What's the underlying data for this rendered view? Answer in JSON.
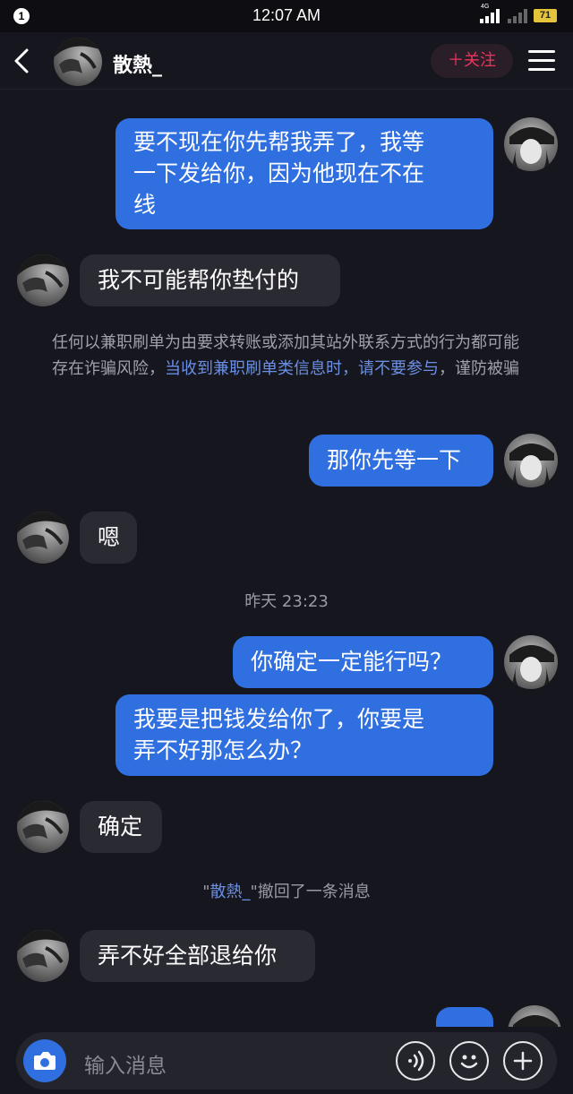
{
  "status_bar": {
    "notification_count": "1",
    "time": "12:07 AM",
    "network": "4G",
    "battery": "71"
  },
  "header": {
    "contact_name": "散熱_",
    "follow_label": "关注"
  },
  "messages": [
    {
      "from": "me",
      "text_lines": [
        "要不现在你先帮我弄了，我等",
        "一下发给你，因为他现在不在",
        "线"
      ]
    },
    {
      "from": "them",
      "text_lines": [
        "我不可能帮你垫付的"
      ]
    },
    {
      "from": "me",
      "text_lines": [
        "那你先等一下"
      ]
    },
    {
      "from": "them",
      "text_lines": [
        "嗯"
      ]
    },
    {
      "from": "me",
      "text_lines": [
        "你确定一定能行吗？"
      ]
    },
    {
      "from": "me",
      "text_lines": [
        "我要是把钱发给你了，你要是",
        "弄不好那怎么办？"
      ]
    },
    {
      "from": "them",
      "text_lines": [
        "确定"
      ]
    },
    {
      "from": "them",
      "text_lines": [
        "弄不好全部退给你"
      ]
    }
  ],
  "warning": {
    "part1": "任何以兼职刷单为由要求转账或添加其站外联系方式的行为都可能存在诈骗风险，",
    "part2": "当收到兼职刷单类信息时，请不要参与",
    "part3": "，谨防被骗"
  },
  "timestamp": "昨天 23:23",
  "recall": {
    "quote_open": "\"",
    "name": "散熱_",
    "text": "\"撤回了一条消息"
  },
  "input": {
    "placeholder": "输入消息"
  },
  "colors": {
    "background": "#16161e",
    "my_bubble": "#2f6fe0",
    "their_bubble": "#2a2a32",
    "follow_accent": "#f0335d",
    "link_blue": "#6b8fe3"
  }
}
